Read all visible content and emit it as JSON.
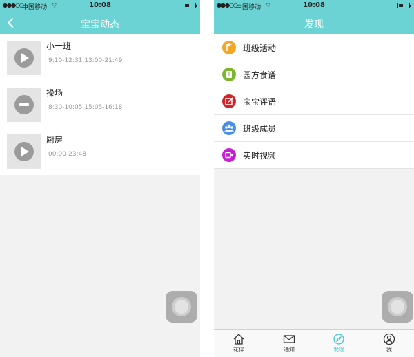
{
  "left": {
    "status": {
      "signal": "●●●○○",
      "carrier": "中国移动",
      "time": "10:08"
    },
    "nav": {
      "title": "宝宝动态"
    },
    "cameras": [
      {
        "name": "小一班",
        "hours": "9:10-12:31,13:00-21:49",
        "state": "play"
      },
      {
        "name": "操场",
        "hours": "8:30-10:05,15:05-16:18",
        "state": "stop"
      },
      {
        "name": "厨房",
        "hours": "00:00-23:48",
        "state": "play"
      }
    ]
  },
  "right": {
    "status": {
      "signal": "●●●○○",
      "carrier": "中国移动",
      "time": "10:08"
    },
    "nav": {
      "title": "发现"
    },
    "menu": [
      {
        "label": "班级活动",
        "icon": "flag-icon",
        "color": "#f5a623"
      },
      {
        "label": "园方食谱",
        "icon": "recipe-icon",
        "color": "#7cb530"
      },
      {
        "label": "宝宝评语",
        "icon": "comment-edit-icon",
        "color": "#d0242b"
      },
      {
        "label": "班级成员",
        "icon": "members-icon",
        "color": "#4a90e2"
      },
      {
        "label": "实时视频",
        "icon": "video-icon",
        "color": "#c41fd0"
      }
    ],
    "tabs": [
      {
        "label": "花伴",
        "icon": "home-icon"
      },
      {
        "label": "通知",
        "icon": "mail-icon"
      },
      {
        "label": "发现",
        "icon": "compass-icon",
        "active": true
      },
      {
        "label": "我",
        "icon": "user-icon"
      }
    ]
  },
  "colors": {
    "header": "#6bd3d3",
    "tab_active": "#3cc6cf"
  }
}
